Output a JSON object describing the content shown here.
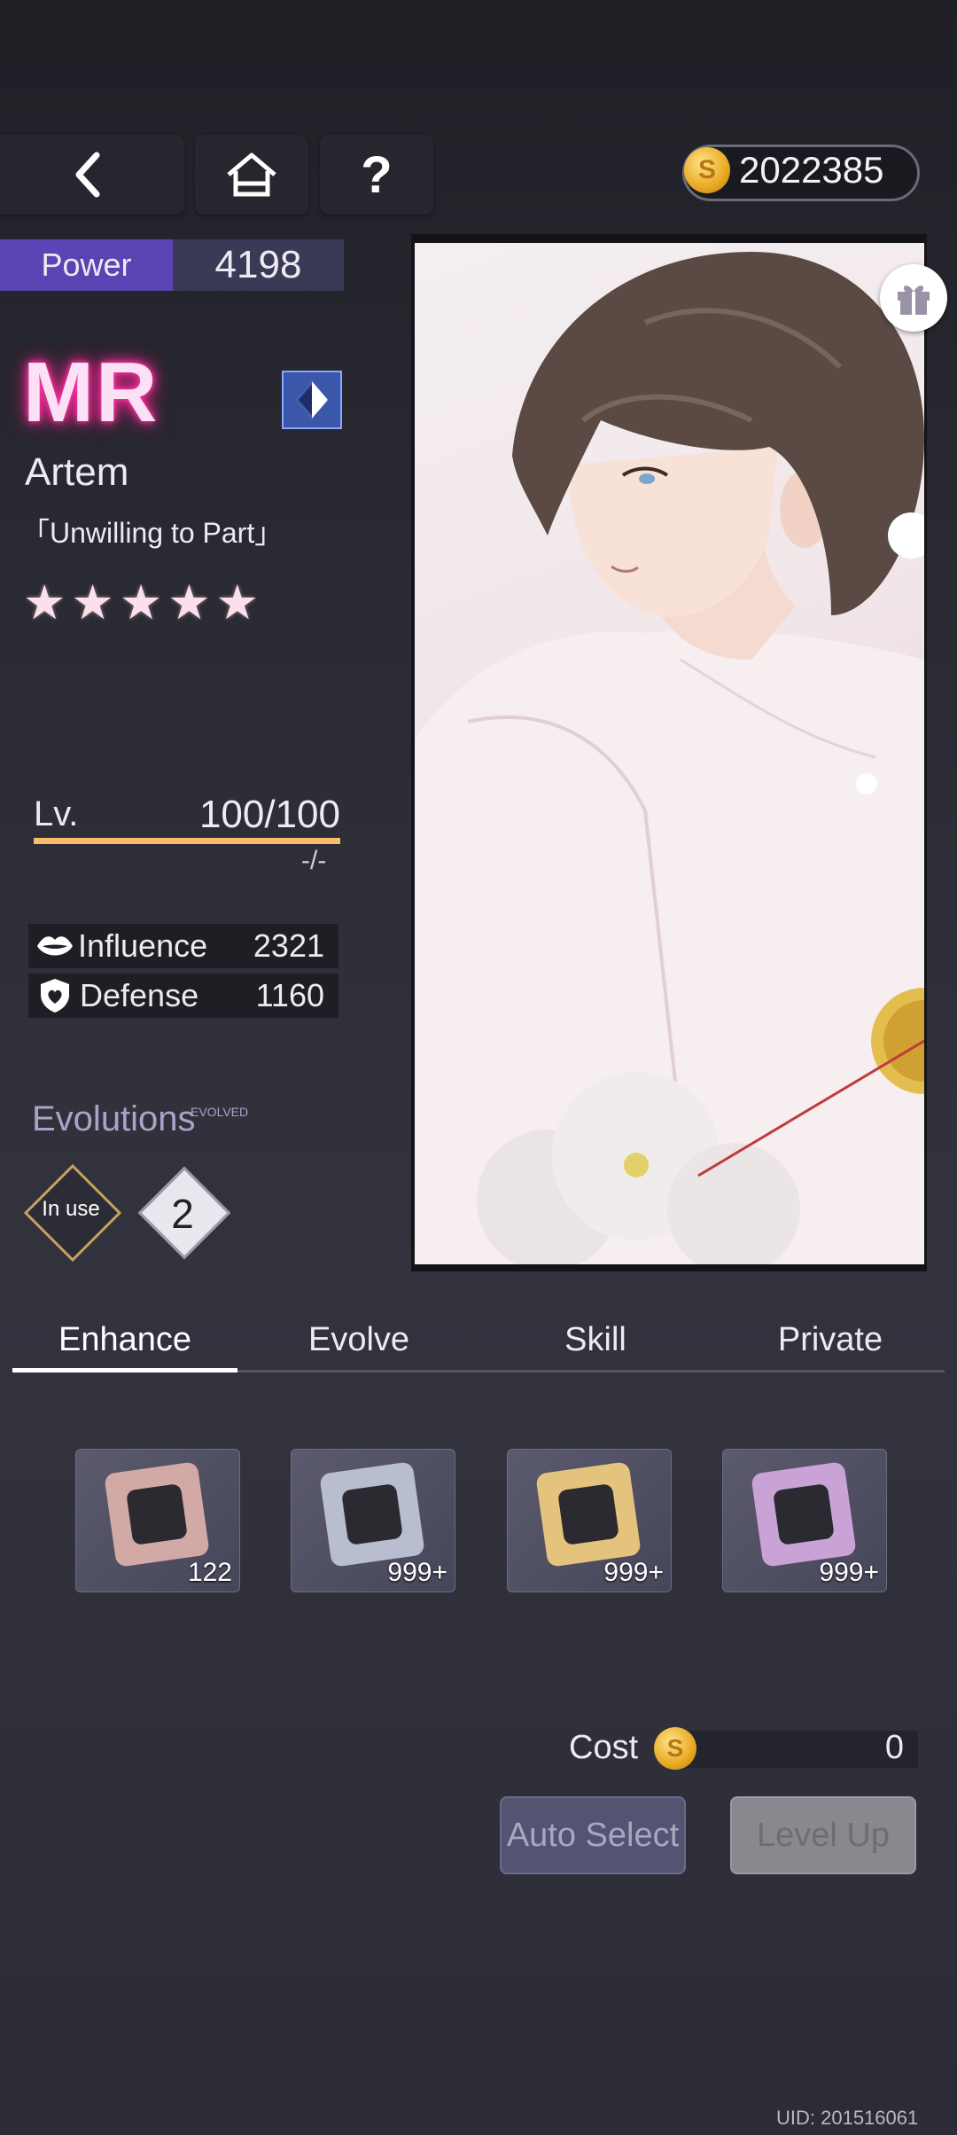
{
  "header": {
    "back_icon": "chevron-left-icon",
    "home_icon": "home-icon",
    "help_label": "?",
    "coins": "2022385",
    "coin_symbol": "S"
  },
  "power": {
    "label": "Power",
    "value": "4198"
  },
  "card": {
    "rarity": "MR",
    "name": "Artem",
    "title": "「Unwilling to Part」",
    "stars": 5,
    "star_glyphs": "★★★★★"
  },
  "level": {
    "label": "Lv.",
    "value": "100/100",
    "sub": "-/-",
    "progress": 1.0
  },
  "stats": [
    {
      "icon": "lips-icon",
      "label": "Influence",
      "value": "2321"
    },
    {
      "icon": "shield-heart-icon",
      "label": "Defense",
      "value": "1160"
    }
  ],
  "evolutions": {
    "label": "Evolutions",
    "tag": "EVOLVED",
    "in_use_label": "In use",
    "next_label": "2"
  },
  "tabs": [
    {
      "label": "Enhance",
      "active": true
    },
    {
      "label": "Evolve",
      "active": false
    },
    {
      "label": "Skill",
      "active": false
    },
    {
      "label": "Private",
      "active": false
    }
  ],
  "items": [
    {
      "qty": "122",
      "color": "#d3a9a6"
    },
    {
      "qty": "999+",
      "color": "#b8bed0"
    },
    {
      "qty": "999+",
      "color": "#e4c37c"
    },
    {
      "qty": "999+",
      "color": "#c9a2d6"
    }
  ],
  "cost": {
    "label": "Cost",
    "value": "0"
  },
  "buttons": {
    "auto_select": "Auto Select",
    "level_up": "Level Up"
  },
  "uid": "UID: 201516061",
  "colors": {
    "accent_purple": "#5a43b2",
    "level_bar": "#f6be6a",
    "rarity_glow": "#ff2d9b"
  }
}
